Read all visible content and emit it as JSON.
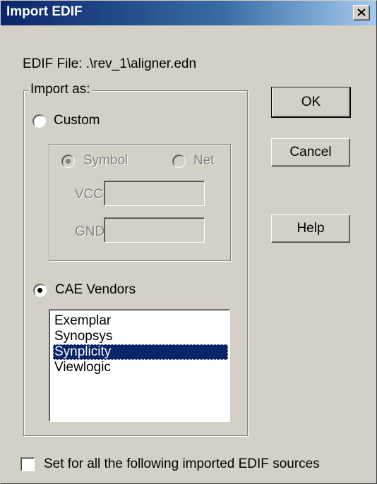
{
  "window": {
    "title": "Import EDIF",
    "close_glyph": "✕"
  },
  "edif_file": {
    "label": "EDIF File: .\\rev_1\\aligner.edn"
  },
  "import_group": {
    "legend": "Import as:"
  },
  "custom": {
    "label": "Custom",
    "selected": false,
    "options": {
      "symbol_label": "Symbol",
      "net_label": "Net",
      "selected": "Symbol",
      "enabled": false
    },
    "vcc_label": "VCC",
    "vcc_value": "",
    "gnd_label": "GND",
    "gnd_value": ""
  },
  "cae_vendors": {
    "label": "CAE Vendors",
    "selected": true,
    "items": [
      "Exemplar",
      "Synopsys",
      "Synplicity",
      "Viewlogic"
    ],
    "selected_item": "Synplicity"
  },
  "buttons": {
    "ok": "OK",
    "cancel": "Cancel",
    "help": "Help"
  },
  "set_all": {
    "label": "Set for all the following imported EDIF sources",
    "checked": false
  },
  "colors": {
    "face": "#d4d0c8",
    "selection": "#0a246a",
    "title_start": "#0a246a",
    "title_end": "#a6caf0"
  }
}
